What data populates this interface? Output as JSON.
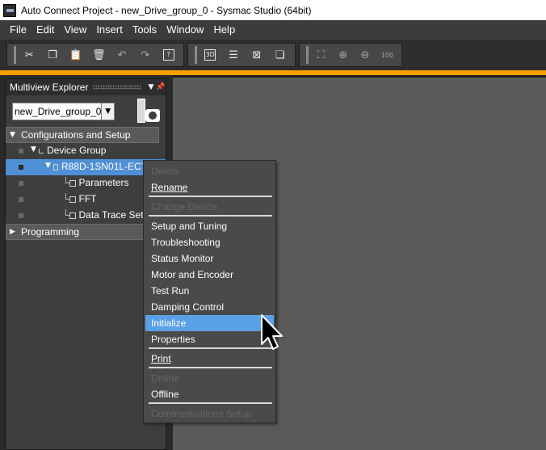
{
  "window": {
    "title": "Auto Connect Project - new_Drive_group_0 - Sysmac Studio (64bit)"
  },
  "menubar": {
    "items": [
      "File",
      "Edit",
      "View",
      "Insert",
      "Tools",
      "Window",
      "Help"
    ]
  },
  "toolbar": {
    "group1": [
      "cut-icon",
      "copy-icon",
      "paste-icon",
      "delete-icon",
      "undo-icon",
      "redo-icon",
      "help-icon"
    ],
    "group2": [
      "3d-view-icon",
      "tree-view-icon",
      "cross-reference-icon",
      "window-layout-icon"
    ],
    "group3": [
      "fit-icon",
      "zoom-in-icon",
      "zoom-out-icon",
      "zoom-100-icon"
    ],
    "label_3d": "3D",
    "label_100": "100"
  },
  "explorer": {
    "title": "Multiview Explorer",
    "combo_value": "new_Drive_group_0",
    "sections": {
      "config": "Configurations and Setup",
      "programming": "Programming"
    },
    "tree": {
      "device_group": "Device Group",
      "device": "R88D-1SN01L-ECT",
      "parameters": "Parameters",
      "fft": "FFT",
      "data_trace": "Data Trace Settings"
    }
  },
  "context_menu": {
    "items": [
      {
        "label": "Delete",
        "enabled": false
      },
      {
        "label": "Rename",
        "enabled": true
      },
      {
        "label": "Change Device",
        "enabled": false
      },
      {
        "label": "Setup and Tuning",
        "enabled": true
      },
      {
        "label": "Troubleshooting",
        "enabled": true
      },
      {
        "label": "Status Monitor",
        "enabled": true
      },
      {
        "label": "Motor and Encoder",
        "enabled": true
      },
      {
        "label": "Test Run",
        "enabled": true
      },
      {
        "label": "Damping Control",
        "enabled": true
      },
      {
        "label": "Initialize",
        "enabled": true,
        "highlighted": true
      },
      {
        "label": "Properties",
        "enabled": true
      },
      {
        "label": "Print",
        "enabled": true
      },
      {
        "label": "Online",
        "enabled": false
      },
      {
        "label": "Offline",
        "enabled": true
      },
      {
        "label": "Communications Setup",
        "enabled": false
      }
    ]
  },
  "colors": {
    "accent": "#f6a000",
    "selection": "#4f8fd6",
    "menu_highlight": "#5aa0e6"
  }
}
